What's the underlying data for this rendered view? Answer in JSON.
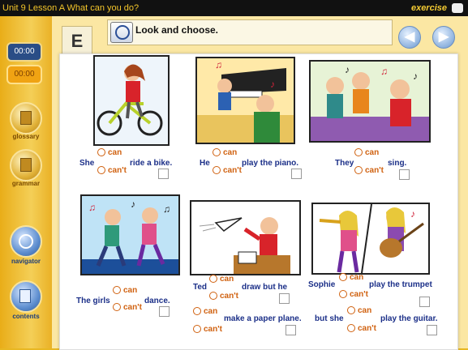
{
  "window": {
    "title": "Unit 9 Lesson A What can you do?",
    "exercise_label": "exercise"
  },
  "sidebar": {
    "timer1": "00:00",
    "timer2": "00:00",
    "items": [
      {
        "label": "glossary"
      },
      {
        "label": "grammar"
      },
      {
        "label": "navigator"
      },
      {
        "label": "contents"
      }
    ]
  },
  "header": {
    "section_letter": "E",
    "instruction": "Look and choose."
  },
  "options": {
    "can": "can",
    "cant": "can't"
  },
  "items": [
    {
      "pre": "She",
      "post": "ride a bike."
    },
    {
      "pre": "He",
      "post": "play the piano."
    },
    {
      "pre": "They",
      "post": "sing."
    },
    {
      "pre": "The girls",
      "post": "dance."
    },
    {
      "pre": "Ted",
      "mid": "draw but he",
      "post": "make a paper plane."
    },
    {
      "pre": "Sophie",
      "mid": "play the trumpet",
      "pre2": "but she",
      "post": "play the guitar."
    }
  ]
}
